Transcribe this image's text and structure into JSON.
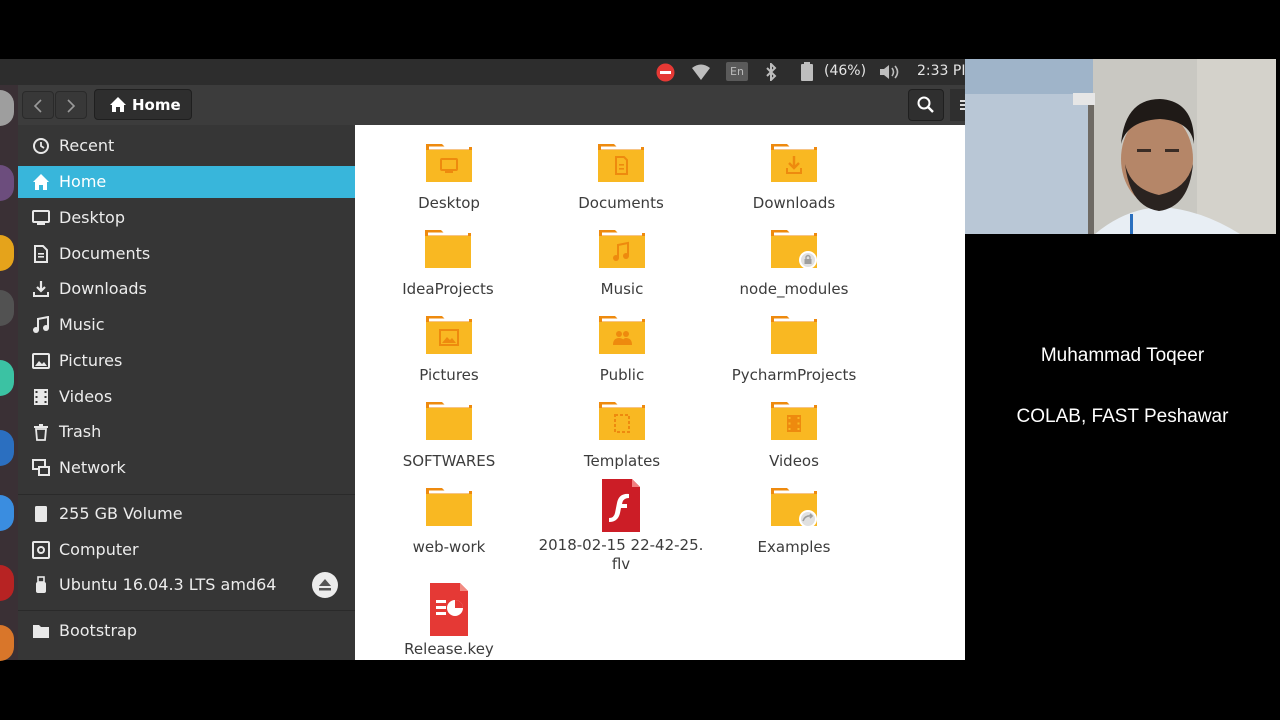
{
  "topbar": {
    "battery_text": "(46%)",
    "clock": "2:33 PI",
    "keyboard_layout": "En"
  },
  "header": {
    "back_icon": "chevron-left-icon",
    "forward_icon": "chevron-right-icon",
    "path_label": "Home"
  },
  "sidebar": {
    "places": [
      {
        "label": "Recent",
        "icon": "clock-icon"
      },
      {
        "label": "Home",
        "icon": "home-icon",
        "active": true
      },
      {
        "label": "Desktop",
        "icon": "desktop-icon"
      },
      {
        "label": "Documents",
        "icon": "document-icon"
      },
      {
        "label": "Downloads",
        "icon": "download-icon"
      },
      {
        "label": "Music",
        "icon": "music-icon"
      },
      {
        "label": "Pictures",
        "icon": "picture-icon"
      },
      {
        "label": "Videos",
        "icon": "film-icon"
      },
      {
        "label": "Trash",
        "icon": "trash-icon"
      },
      {
        "label": "Network",
        "icon": "network-icon"
      }
    ],
    "devices": [
      {
        "label": "255 GB Volume",
        "icon": "drive-icon"
      },
      {
        "label": "Computer",
        "icon": "computer-icon"
      },
      {
        "label": "Ubuntu 16.04.3 LTS amd64",
        "icon": "usb-icon"
      }
    ],
    "bookmarks": [
      {
        "label": "Bootstrap",
        "icon": "folder-icon"
      }
    ]
  },
  "files": [
    {
      "name": "Desktop",
      "type": "folder"
    },
    {
      "name": "Documents",
      "type": "folder"
    },
    {
      "name": "Downloads",
      "type": "folder"
    },
    {
      "name": "IdeaProjects",
      "type": "folder"
    },
    {
      "name": "Music",
      "type": "folder"
    },
    {
      "name": "node_modules",
      "type": "folder"
    },
    {
      "name": "Pictures",
      "type": "folder"
    },
    {
      "name": "Public",
      "type": "folder"
    },
    {
      "name": "PycharmProjects",
      "type": "folder"
    },
    {
      "name": "SOFTWARES",
      "type": "folder"
    },
    {
      "name": "Templates",
      "type": "folder"
    },
    {
      "name": "Videos",
      "type": "folder"
    },
    {
      "name": "web-work",
      "type": "folder"
    },
    {
      "name": "2018-02-15 22-42-25.\nflv",
      "type": "flash"
    },
    {
      "name": "Examples",
      "type": "folder"
    },
    {
      "name": "Release.key",
      "type": "key"
    }
  ],
  "overlay": {
    "presenter_name": "Muhammad Toqeer",
    "presenter_org": "COLAB, FAST Peshawar"
  },
  "colors": {
    "accent": "#38b6db",
    "folder": "#f9b822",
    "folder_tab": "#ee8a0e",
    "sidebar_bg": "#363636",
    "flash_red": "#cc1d26"
  }
}
